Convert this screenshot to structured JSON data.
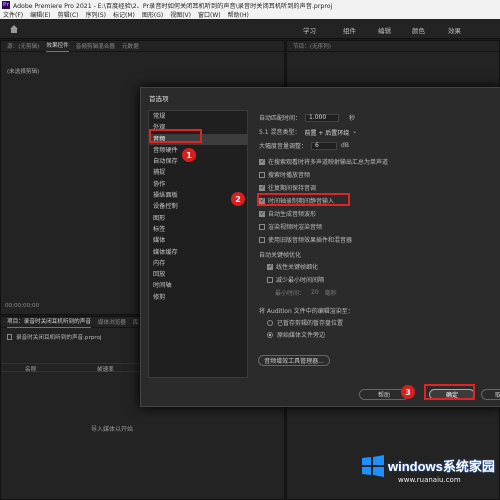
{
  "window": {
    "title": "Adobe Premiere Pro 2021 - E:\\百度经验\\2、Pr录音时如何关闭耳机听到的声音\\录音时关闭耳机听到的声音.prproj",
    "app_badge": "Pr"
  },
  "menu": [
    "文件(F)",
    "编辑(E)",
    "剪辑(C)",
    "序列(S)",
    "标记(M)",
    "图形(G)",
    "视图(V)",
    "窗口(W)",
    "帮助(H)"
  ],
  "workspace_tabs": [
    "学习",
    "组件",
    "编辑",
    "颜色",
    "效果"
  ],
  "left_panel": {
    "tabs": [
      "源：(无剪辑)",
      "效果控件",
      "音频剪辑混合器",
      "元数据"
    ],
    "clip_label": "(未选择剪辑)",
    "timecode": "00;00;00;00"
  },
  "right_panel": {
    "tabs": [
      "节目：(无序列)"
    ]
  },
  "project_panel": {
    "tabs": [
      "项目：录音时关闭耳机听到的声音",
      "媒体浏览器",
      "库"
    ],
    "file": "录音时关闭耳机听到的声音.prproj",
    "columns": [
      "名称",
      "帧速率"
    ],
    "empty_text": "导入媒体以开始"
  },
  "dialog": {
    "title": "首选项",
    "categories": [
      "常规",
      "外观",
      "音频",
      "音频硬件",
      "自动保存",
      "捕捉",
      "协作",
      "操纵面板",
      "设备控制",
      "图形",
      "标签",
      "媒体",
      "媒体缓存",
      "内存",
      "回放",
      "时间轴",
      "修剪"
    ],
    "selected_category": "音频",
    "settings": {
      "automatch_label": "自动匹配时间：",
      "automatch_value": "1.000",
      "automatch_unit": "秒",
      "downmix_label": "5.1 混音类型：",
      "downmix_value": "前置 + 后置环绕",
      "zoom_label": "大幅度音量调整：",
      "zoom_value": "6",
      "zoom_unit": "dB",
      "checks": [
        {
          "label": "在搜索观看时将多声道映射输出汇总为单声道",
          "checked": true
        },
        {
          "label": "搜索时播放音频",
          "checked": false
        },
        {
          "label": "往复期间保持音调",
          "checked": true
        },
        {
          "label": "时间轴录制期间静音输入",
          "checked": true
        },
        {
          "label": "自动生成音频波形",
          "checked": true
        },
        {
          "label": "渲染视频时渲染音频",
          "checked": false
        },
        {
          "label": "使用旧版音频效果插件和混音器",
          "checked": false
        }
      ],
      "keyframe_group": "自动关键帧优化",
      "keyframe_checks": [
        {
          "label": "线性关键帧细化",
          "checked": true
        },
        {
          "label": "减少最小时间间隔",
          "checked": false
        }
      ],
      "min_time_label": "最小时间：",
      "min_time_value": "20",
      "min_time_unit": "毫秒",
      "audition_label": "将 Audition 文件中的编辑渲染至：",
      "audition_radios": [
        {
          "label": "已暂存剪辑的暂存盘位置",
          "selected": false
        },
        {
          "label": "原始媒体文件旁边",
          "selected": true
        }
      ],
      "audio_plugin_button": "音频增效工具管理器..."
    },
    "help_button": "帮助",
    "ok_button": "确定",
    "cancel_button": "取消"
  },
  "annotations": [
    {
      "step": "1",
      "color": "#e02424"
    },
    {
      "step": "2",
      "color": "#e02424"
    },
    {
      "step": "3",
      "color": "#e02424"
    }
  ],
  "watermark": {
    "brand": "windows系统家园",
    "url": "www.ruanaiu.com"
  }
}
